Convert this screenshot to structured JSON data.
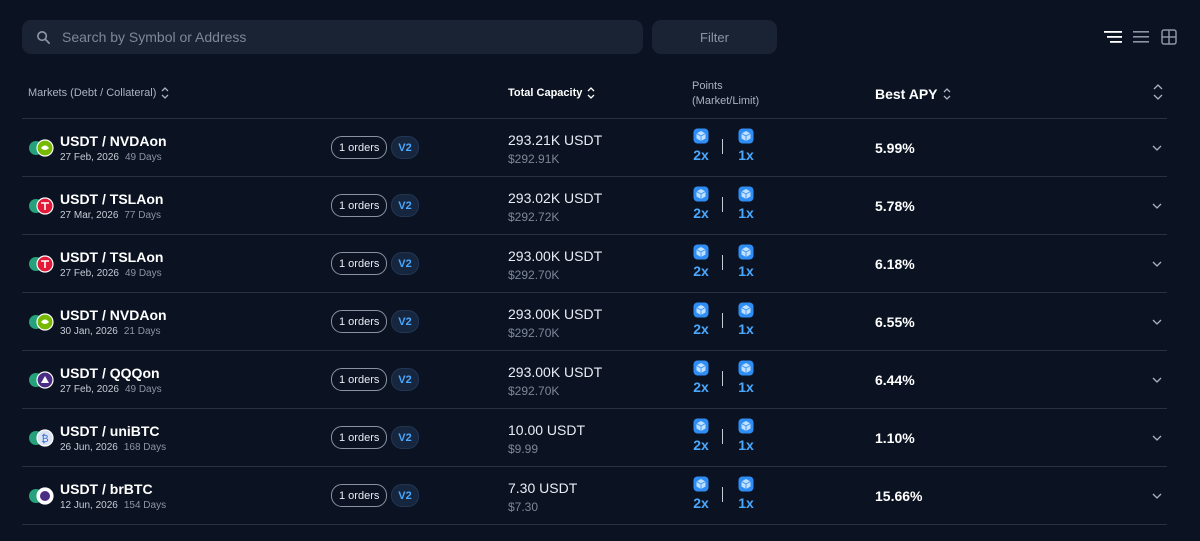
{
  "search": {
    "placeholder": "Search by Symbol or Address",
    "value": ""
  },
  "filter": {
    "label": "Filter"
  },
  "view_toggle": [
    "list-detail-icon",
    "list-compact-icon",
    "grid-icon"
  ],
  "columns": {
    "markets": "Markets (Debt / Collateral)",
    "capacity": "Total Capacity",
    "points_line1": "Points",
    "points_line2": "(Market/Limit)",
    "apy": "Best APY"
  },
  "colors": {
    "background": "#0b1322",
    "accent": "#4aa8ff",
    "divider": "#283244"
  },
  "rows": [
    {
      "pair": "USDT / NVDAon",
      "date": "27 Feb, 2026",
      "days": "49 Days",
      "orders": "1 orders",
      "version": "V2",
      "capacity": "293.21K USDT",
      "capacity_usd": "$292.91K",
      "points_market": "2x",
      "points_limit": "1x",
      "apy": "5.99%",
      "logo": "nvidia"
    },
    {
      "pair": "USDT / TSLAon",
      "date": "27 Mar, 2026",
      "days": "77 Days",
      "orders": "1 orders",
      "version": "V2",
      "capacity": "293.02K USDT",
      "capacity_usd": "$292.72K",
      "points_market": "2x",
      "points_limit": "1x",
      "apy": "5.78%",
      "logo": "tesla"
    },
    {
      "pair": "USDT / TSLAon",
      "date": "27 Feb, 2026",
      "days": "49 Days",
      "orders": "1 orders",
      "version": "V2",
      "capacity": "293.00K USDT",
      "capacity_usd": "$292.70K",
      "points_market": "2x",
      "points_limit": "1x",
      "apy": "6.18%",
      "logo": "tesla"
    },
    {
      "pair": "USDT / NVDAon",
      "date": "30 Jan, 2026",
      "days": "21 Days",
      "orders": "1 orders",
      "version": "V2",
      "capacity": "293.00K USDT",
      "capacity_usd": "$292.70K",
      "points_market": "2x",
      "points_limit": "1x",
      "apy": "6.55%",
      "logo": "nvidia"
    },
    {
      "pair": "USDT / QQQon",
      "date": "27 Feb, 2026",
      "days": "49 Days",
      "orders": "1 orders",
      "version": "V2",
      "capacity": "293.00K USDT",
      "capacity_usd": "$292.70K",
      "points_market": "2x",
      "points_limit": "1x",
      "apy": "6.44%",
      "logo": "qqq"
    },
    {
      "pair": "USDT / uniBTC",
      "date": "26 Jun, 2026",
      "days": "168 Days",
      "orders": "1 orders",
      "version": "V2",
      "capacity": "10.00 USDT",
      "capacity_usd": "$9.99",
      "points_market": "2x",
      "points_limit": "1x",
      "apy": "1.10%",
      "logo": "unibtc"
    },
    {
      "pair": "USDT / brBTC",
      "date": "12 Jun, 2026",
      "days": "154 Days",
      "orders": "1 orders",
      "version": "V2",
      "capacity": "7.30 USDT",
      "capacity_usd": "$7.30",
      "points_market": "2x",
      "points_limit": "1x",
      "apy": "15.66%",
      "logo": "brbtc"
    }
  ]
}
